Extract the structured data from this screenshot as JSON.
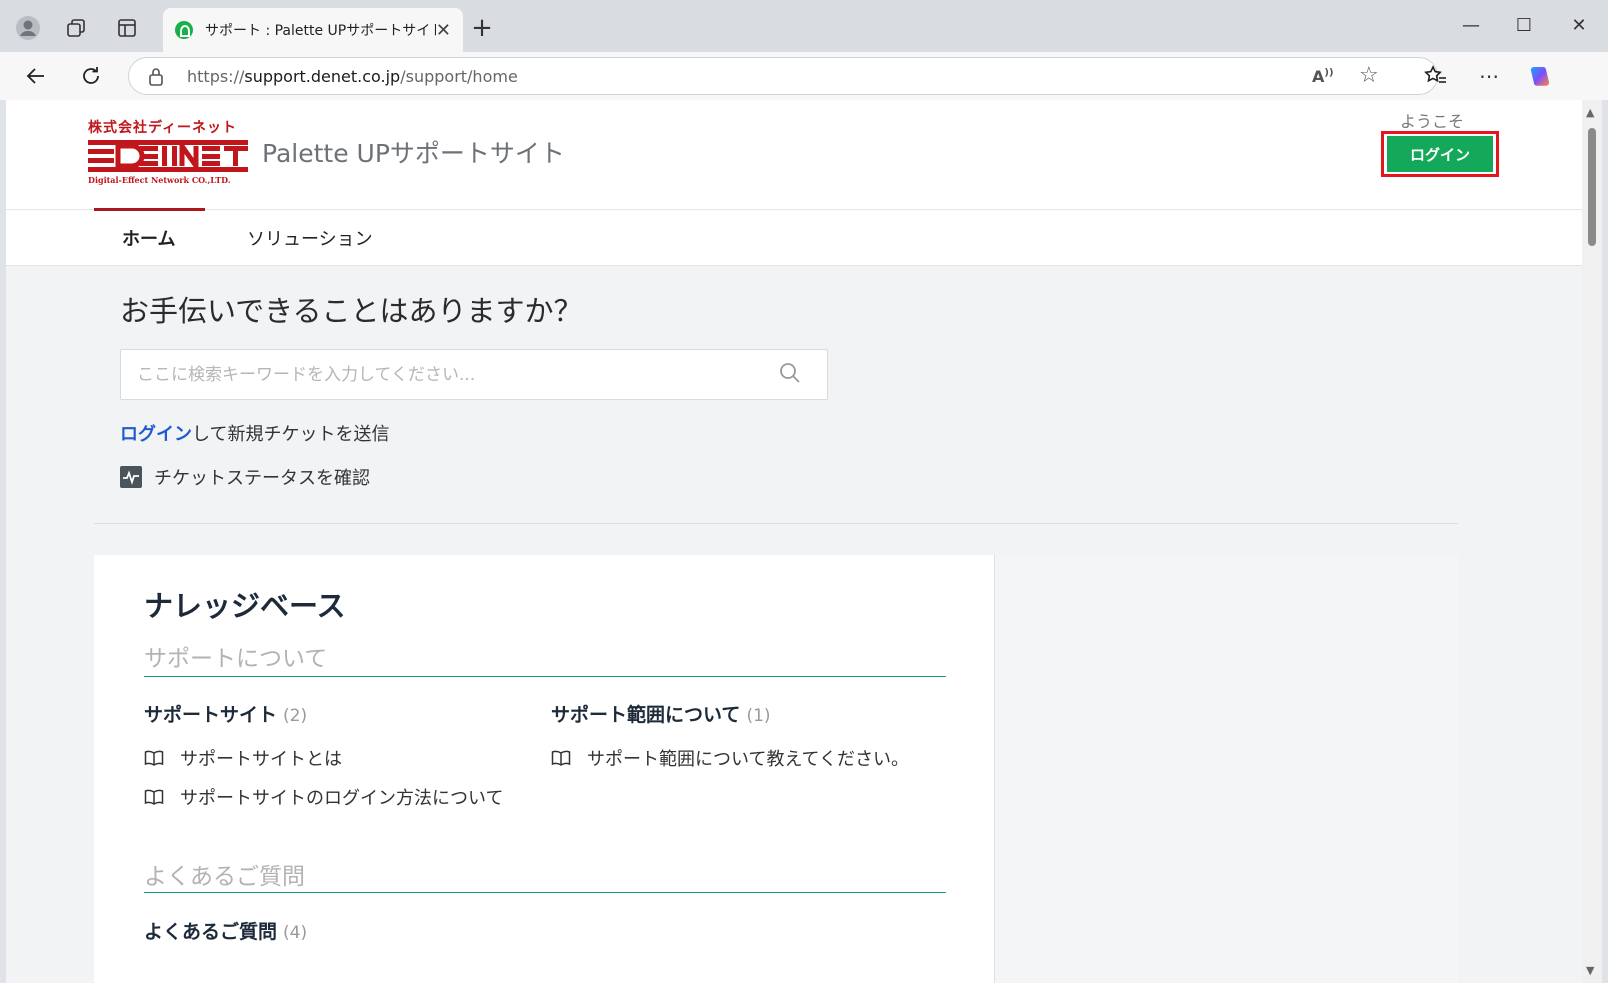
{
  "browser": {
    "tab_title": "サポート : Palette UPサポートサイト",
    "url_prefix": "https://",
    "url_host": "support.denet.co.jp",
    "url_path": "/support/home",
    "new_tab_glyph": "+",
    "tab_close_glyph": "✕",
    "minimize_glyph": "—",
    "maximize_glyph": "☐",
    "close_glyph": "✕"
  },
  "header": {
    "logo_jp": "株式会社ディーネット",
    "logo_en": "Digital-Effect Network CO.,LTD.",
    "site_title": "Palette UPサポートサイト",
    "welcome": "ようこそ",
    "login_button": "ログイン",
    "brand_color": "#c0161c",
    "login_color": "#14a85a"
  },
  "nav": {
    "items": [
      "ホーム",
      "ソリューション"
    ],
    "active": "ホーム"
  },
  "hero": {
    "title": "お手伝いできることはありますか？",
    "search_placeholder": "ここに検索キーワードを入力してください...",
    "login_link": "ログイン",
    "login_suffix": "して新規チケットを送信",
    "status_link": "チケットステータスを確認"
  },
  "knowledge_base": {
    "title": "ナレッジベース",
    "sections": [
      {
        "title": "サポートについて",
        "categories": [
          {
            "title": "サポートサイト",
            "count": "(2)",
            "articles": [
              "サポートサイトとは",
              "サポートサイトのログイン方法について"
            ]
          },
          {
            "title": "サポート範囲について",
            "count": "(1)",
            "articles": [
              "サポート範囲について教えてください。"
            ]
          }
        ]
      },
      {
        "title": "よくあるご質問",
        "categories": [
          {
            "title": "よくあるご質問",
            "count": "(4)",
            "articles": []
          }
        ]
      }
    ]
  }
}
